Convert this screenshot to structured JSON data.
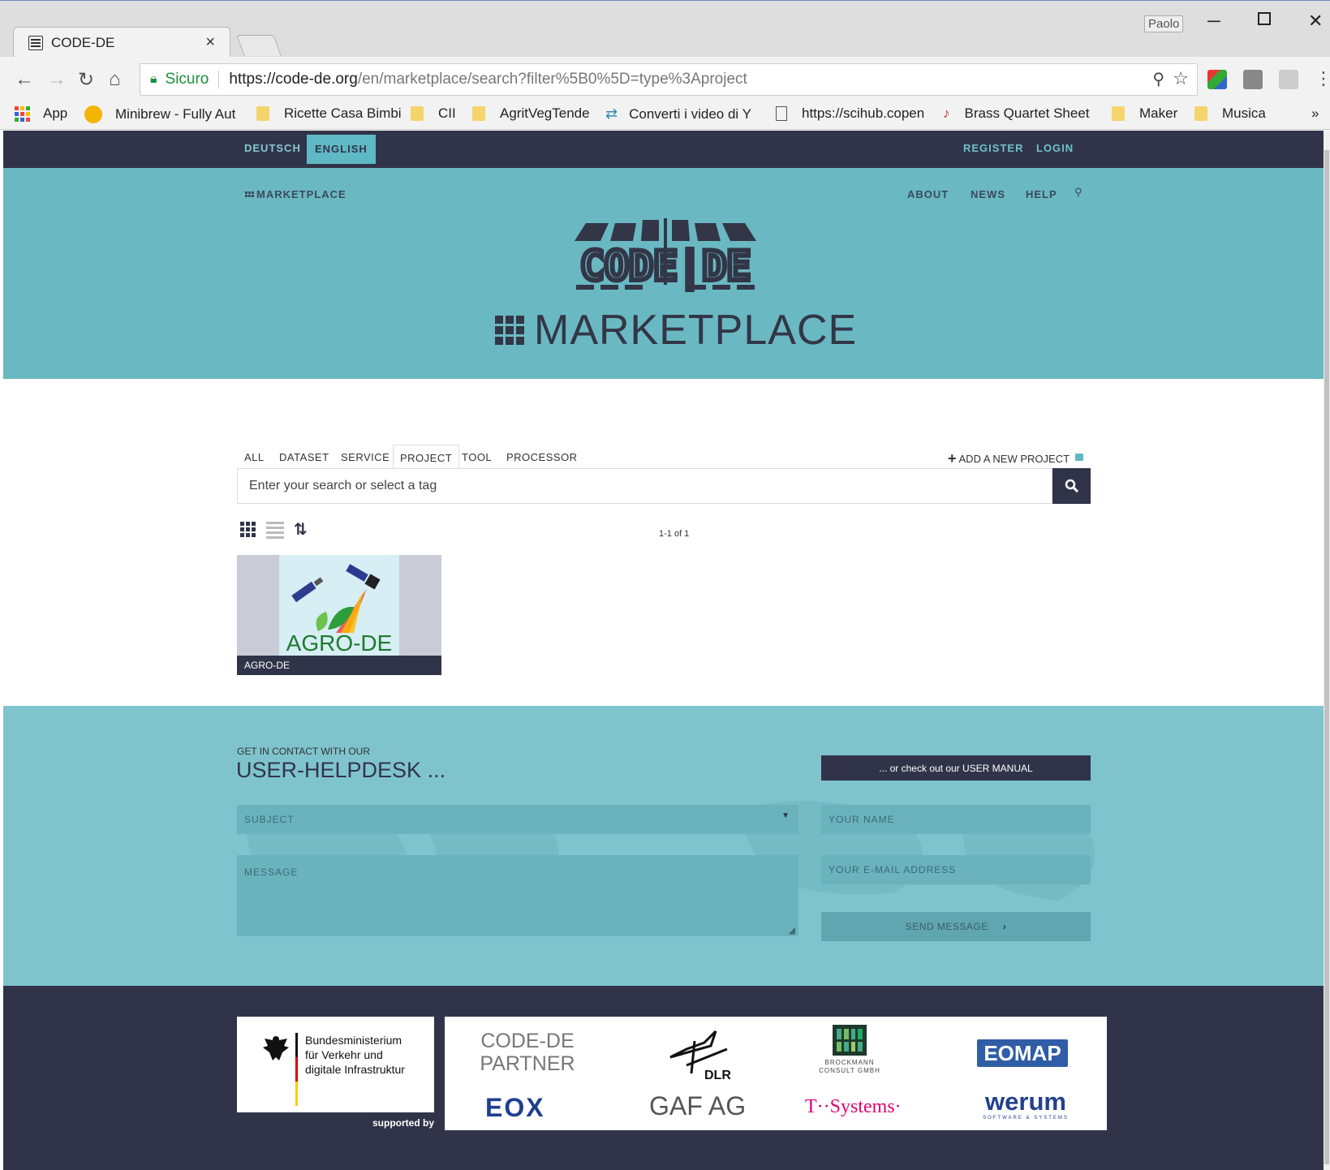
{
  "browser": {
    "tab_title": "CODE-DE",
    "tab_close": "×",
    "user_name": "Paolo",
    "secure_label": "Sicuro",
    "url_host": "https://code-de.org",
    "url_path": "/en/marketplace/search?filter%5B0%5D=type%3Aproject",
    "bookmarks": [
      {
        "label": "App"
      },
      {
        "label": "Minibrew - Fully Aut"
      },
      {
        "label": "Ricette Casa Bimbi"
      },
      {
        "label": "CII"
      },
      {
        "label": "AgritVegTende"
      },
      {
        "label": "Converti i video di Y"
      },
      {
        "label": "https://scihub.copen"
      },
      {
        "label": "Brass Quartet Sheet"
      },
      {
        "label": "Maker"
      },
      {
        "label": "Musica"
      }
    ],
    "bookmarks_more": "»"
  },
  "site": {
    "lang_de": "DEUTSCH",
    "lang_en": "ENGLISH",
    "register": "REGISTER",
    "login": "LOGIN",
    "nav_marketplace": "MARKETPLACE",
    "nav_about": "ABOUT",
    "nav_news": "NEWS",
    "nav_help": "HELP",
    "logo_text": "CODE|DE",
    "hero_title": "MARKETPLACE"
  },
  "search": {
    "filters": [
      {
        "label": "ALL"
      },
      {
        "label": "DATASET"
      },
      {
        "label": "SERVICE"
      },
      {
        "label": "PROJECT"
      },
      {
        "label": "TOOL"
      },
      {
        "label": "PROCESSOR"
      }
    ],
    "active_filter": "PROJECT",
    "add_new": "ADD A NEW PROJECT",
    "placeholder": "Enter your search or select a tag",
    "pager": "1-1 of 1"
  },
  "results": [
    {
      "title": "AGRO-DE",
      "image_text": "AGRO-DE"
    }
  ],
  "helpdesk": {
    "intro": "GET IN CONTACT WITH OUR",
    "title": "USER-HELPDESK ...",
    "manual_button": "... or check out our USER MANUAL",
    "subject_placeholder": "SUBJECT",
    "message_placeholder": "MESSAGE",
    "name_placeholder": "YOUR NAME",
    "email_placeholder": "YOUR E-MAIL ADDRESS",
    "send_button": "SEND MESSAGE"
  },
  "footer": {
    "ministry_line1": "Bundesministerium",
    "ministry_line2": "für Verkehr und",
    "ministry_line3": "digitale Infrastruktur",
    "supported_by": "supported by",
    "partner_label_1": "CODE-DE",
    "partner_label_2": "PARTNER",
    "partners": [
      "DLR",
      "Brockmann Consult GmbH",
      "EOMAP",
      "EOX",
      "GAF AG",
      "T··Systems·",
      "werum"
    ],
    "brockmann_line1": "BROCKMANN",
    "brockmann_line2": "CONSULT GMBH",
    "werum_sub": "SOFTWARE & SYSTEMS"
  },
  "colors": {
    "navy": "#313449",
    "teal": "#6ab8c2",
    "teal_light": "#7fc4cd"
  }
}
